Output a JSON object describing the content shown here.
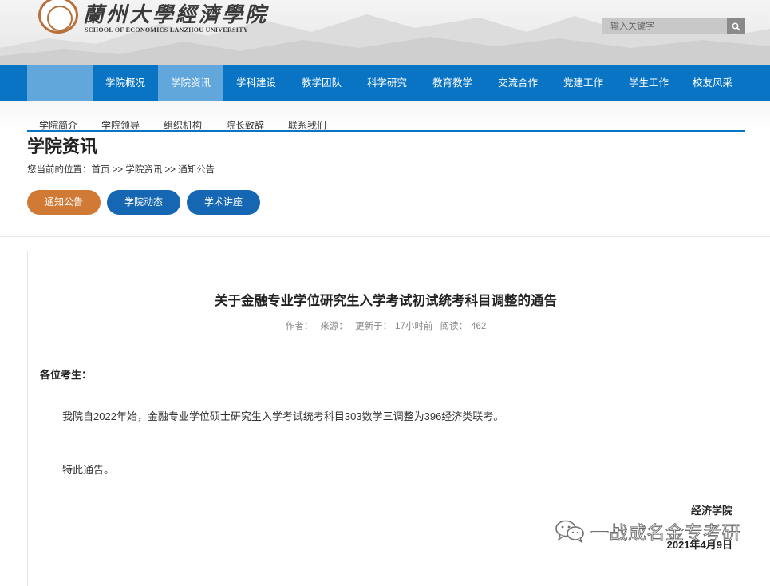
{
  "header": {
    "logo_cn": "蘭州大學經濟學院",
    "logo_en": "SCHOOL OF ECONOMICS LANZHOU UNIVERSITY",
    "search_placeholder": "输入关键字",
    "search_icon": "search-icon"
  },
  "nav": {
    "items": [
      "学院概况",
      "学院资讯",
      "学科建设",
      "教学团队",
      "科学研究",
      "教育教学",
      "交流合作",
      "党建工作",
      "学生工作",
      "校友风采"
    ],
    "active_index": 1,
    "bg_color": "#0a74c4",
    "active_color": "#62a7dc"
  },
  "subnav": {
    "items": [
      "学院简介",
      "学院领导",
      "组织机构",
      "院长致辞",
      "联系我们"
    ]
  },
  "section": {
    "title": "学院资讯",
    "breadcrumb_label": "您当前的位置：",
    "breadcrumb": [
      "首页",
      "学院资讯",
      "通知公告"
    ],
    "breadcrumb_sep": ">>"
  },
  "category_tabs": {
    "items": [
      "通知公告",
      "学院动态",
      "学术讲座"
    ],
    "active_index": 0,
    "active_color": "#d07a35",
    "color": "#1567b4"
  },
  "article": {
    "title": "关于金融专业学位研究生入学考试初试统考科目调整的通告",
    "meta": {
      "author_label": "作者：",
      "source_label": "来源：",
      "updated_label": "更新于：",
      "updated_value": "17小时前",
      "views_label": "阅读：",
      "views_value": "462"
    },
    "salutation": "各位考生：",
    "paragraphs": [
      "我院自2022年始，金融专业学位硕士研究生入学考试统考科目303数学三调整为396经济类联考。",
      "特此通告。"
    ],
    "signature": "经济学院",
    "date": "2021年4月9日"
  },
  "watermark": {
    "text": "一战成名金专考研",
    "icon": "wechat-icon"
  }
}
